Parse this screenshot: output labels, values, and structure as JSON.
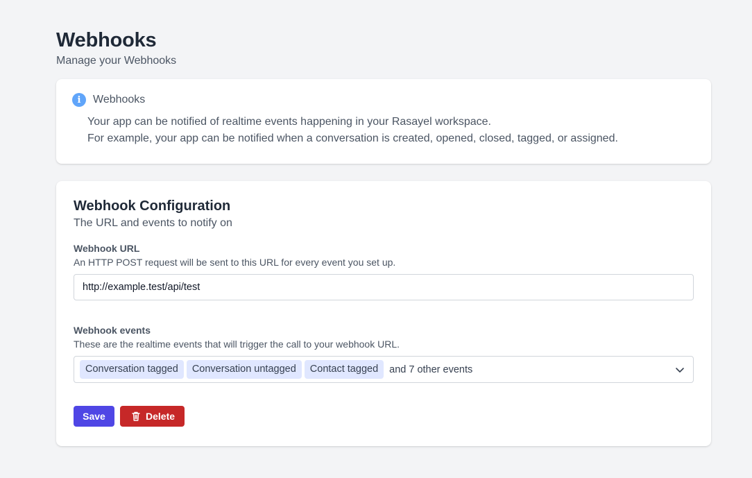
{
  "header": {
    "title": "Webhooks",
    "subtitle": "Manage your Webhooks"
  },
  "info": {
    "icon": "info-icon",
    "title": "Webhooks",
    "line1": "Your app can be notified of realtime events happening in your Rasayel workspace.",
    "line2": "For example, your app can be notified when a conversation is created, opened, closed, tagged, or assigned."
  },
  "config": {
    "title": "Webhook Configuration",
    "subtitle": "The URL and events to notify on",
    "url": {
      "label": "Webhook URL",
      "help": "An HTTP POST request will be sent to this URL for every event you set up.",
      "value": "http://example.test/api/test"
    },
    "events": {
      "label": "Webhook events",
      "help": "These are the realtime events that will trigger the call to your webhook URL.",
      "chips": [
        "Conversation tagged",
        "Conversation untagged",
        "Contact tagged"
      ],
      "more": "and 7 other events"
    },
    "actions": {
      "save": "Save",
      "delete": "Delete"
    }
  },
  "colors": {
    "primary": "#4f46e5",
    "danger": "#c62828",
    "chip_bg": "#e0e7ff",
    "info": "#60a5fa"
  }
}
